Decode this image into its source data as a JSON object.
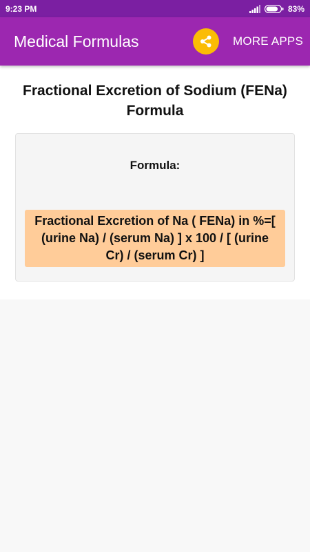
{
  "status_bar": {
    "time": "9:23 PM",
    "battery_percent": "83%",
    "battery_level": 0.83
  },
  "app_bar": {
    "title": "Medical Formulas",
    "share_icon": "share-icon",
    "share_color": "#fbbc05",
    "more_apps_label": "MORE APPS",
    "background_color": "#9c27b0"
  },
  "content": {
    "title": "Fractional Excretion of Sodium (FENa) Formula",
    "formula_label": "Formula:",
    "formula_text": "Fractional Excretion of Na ( FENa) in %=[ (urine Na) / (serum Na) ] x 100 / [ (urine Cr) / (serum Cr) ]",
    "formula_highlight_color": "#ffcc99"
  }
}
